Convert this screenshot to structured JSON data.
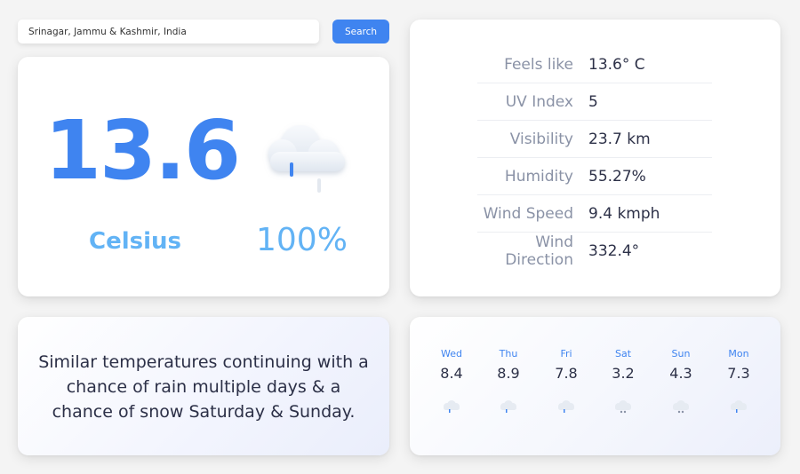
{
  "search": {
    "value": "Srinagar, Jammu & Kashmir, India",
    "button_label": "Search"
  },
  "current": {
    "temperature": "13.6",
    "unit": "Celsius",
    "precipitation": "100%",
    "icon": "cloud-rain-icon"
  },
  "details": [
    {
      "label": "Feels like",
      "value": "13.6° C"
    },
    {
      "label": "UV Index",
      "value": "5"
    },
    {
      "label": "Visibility",
      "value": "23.7 km"
    },
    {
      "label": "Humidity",
      "value": "55.27%"
    },
    {
      "label": "Wind Speed",
      "value": "9.4 kmph"
    },
    {
      "label": "Wind Direction",
      "value": "332.4°"
    }
  ],
  "summary": "Similar temperatures continuing with a chance of rain multiple days & a chance of snow Saturday & Sunday.",
  "forecast": [
    {
      "day": "Wed",
      "temp": "8.4",
      "icon": "cloud-rain-icon"
    },
    {
      "day": "Thu",
      "temp": "8.9",
      "icon": "cloud-rain-icon"
    },
    {
      "day": "Fri",
      "temp": "7.8",
      "icon": "cloud-rain-icon"
    },
    {
      "day": "Sat",
      "temp": "3.2",
      "icon": "cloud-snow-icon"
    },
    {
      "day": "Sun",
      "temp": "4.3",
      "icon": "cloud-snow-icon"
    },
    {
      "day": "Mon",
      "temp": "7.3",
      "icon": "cloud-rain-icon"
    }
  ],
  "colors": {
    "accent": "#3f84f0",
    "light_accent": "#62b3f5",
    "text": "#2c3047",
    "muted": "#8a92a6"
  }
}
